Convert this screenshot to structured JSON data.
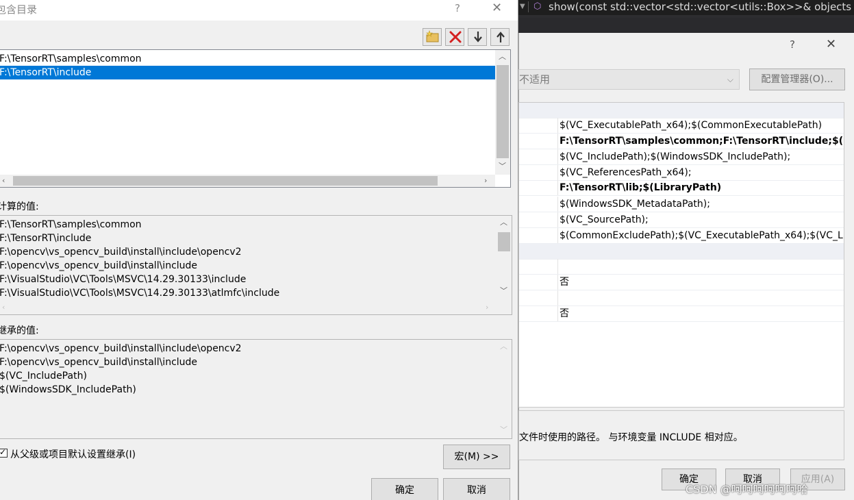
{
  "editor": {
    "signature": "show(const std::vector<std::vector<utils::Box>>& objects"
  },
  "property_dialog": {
    "help": "?",
    "close": "✕",
    "platform_value": "不适用",
    "config_manager_label": "配置管理器(O)...",
    "rows": [
      {
        "value": "",
        "header": true
      },
      {
        "value": "$(VC_ExecutablePath_x64);$(CommonExecutablePath)",
        "bold": false
      },
      {
        "value": "F:\\TensorRT\\samples\\common;F:\\TensorRT\\include;$(In",
        "bold": true
      },
      {
        "value": "$(VC_IncludePath);$(WindowsSDK_IncludePath);",
        "bold": false
      },
      {
        "value": "$(VC_ReferencesPath_x64);",
        "bold": false
      },
      {
        "value": "F:\\TensorRT\\lib;$(LibraryPath)",
        "bold": true
      },
      {
        "value": "$(WindowsSDK_MetadataPath);",
        "bold": false
      },
      {
        "value": "$(VC_SourcePath);",
        "bold": false
      },
      {
        "value": "$(CommonExcludePath);$(VC_ExecutablePath_x64);$(VC_L",
        "bold": false
      },
      {
        "value": "",
        "header": true
      },
      {
        "value": "",
        "bold": false
      },
      {
        "value": "否",
        "bold": false
      },
      {
        "value": "",
        "bold": false
      },
      {
        "value": "否",
        "bold": false
      }
    ],
    "description": "文件时使用的路径。 与环境变量 INCLUDE 相对应。",
    "ok_label": "确定",
    "cancel_label": "取消",
    "apply_label": "应用(A)",
    "watermark": "CSDN @呵呵呵呵呵呵哈"
  },
  "include_dialog": {
    "title": "包含目录",
    "help": "?",
    "close": "✕",
    "toolbar": {
      "new_line": "new-folder-icon",
      "delete": "delete-icon",
      "move_down": "arrow-down-icon",
      "move_up": "arrow-up-icon"
    },
    "entries": [
      "F:\\TensorRT\\samples\\common",
      "F:\\TensorRT\\include"
    ],
    "selected_index": 1,
    "computed_label": "计算的值:",
    "computed_values": [
      "F:\\TensorRT\\samples\\common",
      "F:\\TensorRT\\include",
      "F:\\opencv\\vs_opencv_build\\install\\include\\opencv2",
      "F:\\opencv\\vs_opencv_build\\install\\include",
      "F:\\VisualStudio\\VC\\Tools\\MSVC\\14.29.30133\\include",
      "F:\\VisualStudio\\VC\\Tools\\MSVC\\14.29.30133\\atlmfc\\include"
    ],
    "inherited_label": "继承的值:",
    "inherited_values": [
      "F:\\opencv\\vs_opencv_build\\install\\include\\opencv2",
      "F:\\opencv\\vs_opencv_build\\install\\include",
      "$(VC_IncludePath)",
      "$(WindowsSDK_IncludePath)"
    ],
    "inherit_checkbox_label": "从父级或项目默认设置继承(I)",
    "inherit_checked": true,
    "macro_button_label": "宏(M) >>",
    "ok_label": "确定",
    "cancel_label": "取消"
  },
  "colors": {
    "selection": "#0078d7",
    "delete_red": "#d42020"
  }
}
